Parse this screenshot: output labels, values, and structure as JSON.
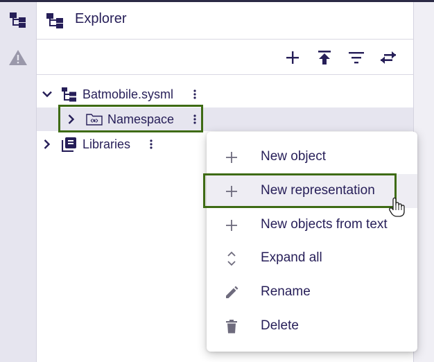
{
  "sidebar": {
    "items": [
      {
        "name": "explorer",
        "icon": "tree-icon"
      },
      {
        "name": "validation",
        "icon": "warning-icon"
      }
    ]
  },
  "explorer": {
    "title": "Explorer",
    "toolbar": {
      "buttons": [
        "new-model-icon",
        "upload-icon",
        "filter-icon",
        "synchronize-icon"
      ]
    },
    "tree": [
      {
        "label": "Batmobile.sysml",
        "expanded": true,
        "icon": "model-tree-icon"
      },
      {
        "label": "Namespace",
        "expanded": false,
        "selected": true,
        "icon": "namespace-folder-icon"
      },
      {
        "label": "Libraries",
        "expanded": false,
        "icon": "library-icon"
      }
    ]
  },
  "context_menu": {
    "items": [
      {
        "label": "New object",
        "icon": "plus-icon"
      },
      {
        "label": "New representation",
        "icon": "plus-icon",
        "hover": true
      },
      {
        "label": "New objects from text",
        "icon": "plus-icon"
      },
      {
        "label": "Expand all",
        "icon": "unfold-icon"
      },
      {
        "label": "Rename",
        "icon": "pencil-icon"
      },
      {
        "label": "Delete",
        "icon": "trash-icon"
      }
    ]
  },
  "colors": {
    "text": "#261e58",
    "highlight_border": "#3e6b14",
    "rail": "#e6e5ef",
    "selected_row": "#e6e5ef",
    "icon_gray": "#8a8798"
  }
}
